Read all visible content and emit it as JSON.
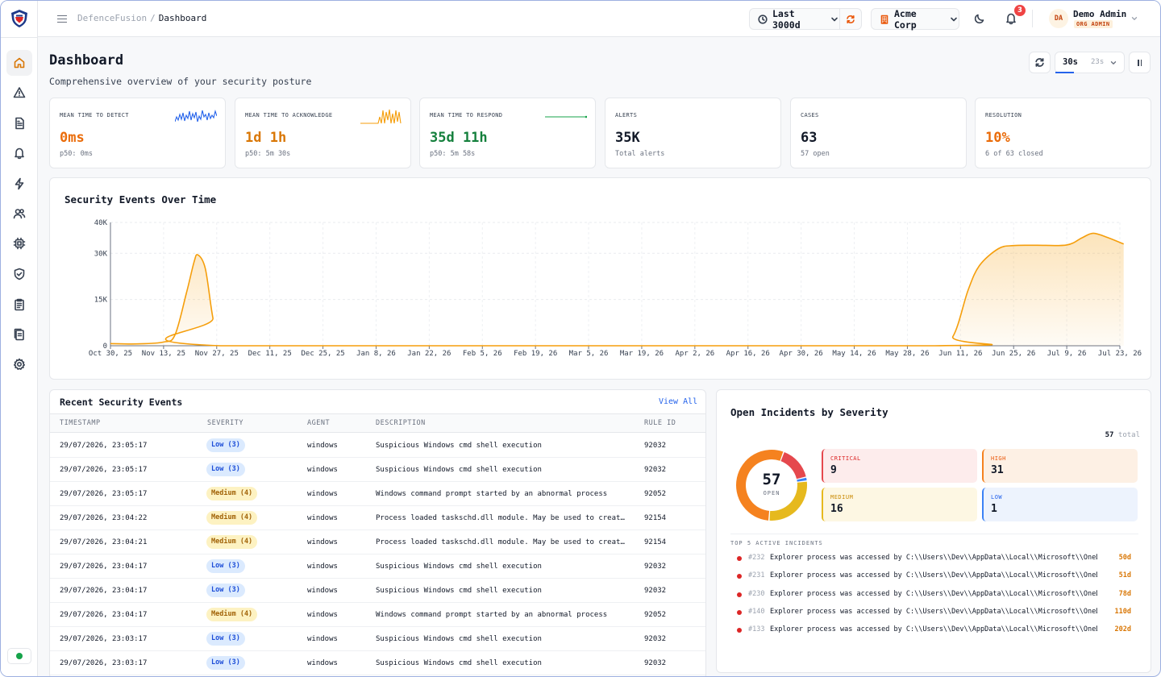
{
  "app": {
    "breadcrumb_root": "DefenceFusion",
    "breadcrumb_sep": "/",
    "breadcrumb_current": "Dashboard"
  },
  "topbar": {
    "time_range": "Last 3000d",
    "org": "Acme Corp",
    "notifications_count": "3",
    "user_initials": "DA",
    "user_name": "Demo Admin",
    "user_role": "ORG ADMIN"
  },
  "page": {
    "title": "Dashboard",
    "subtitle": "Comprehensive overview of your security posture",
    "refresh_interval": "30s",
    "refresh_countdown": "23s"
  },
  "stats": [
    {
      "label": "MEAN TIME TO DETECT",
      "value": "0ms",
      "sub": "p50: 0ms",
      "color": "#ea6c0a",
      "spark": "blue"
    },
    {
      "label": "MEAN TIME TO ACKNOWLEDGE",
      "value": "1d 1h",
      "sub": "p50: 5m 30s",
      "color": "#d97706",
      "spark": "orange"
    },
    {
      "label": "MEAN TIME TO RESPOND",
      "value": "35d 11h",
      "sub": "p50: 5m 58s",
      "color": "#15803d",
      "spark": "green"
    },
    {
      "label": "ALERTS",
      "value": "35K",
      "sub": "Total alerts",
      "color": "#111827"
    },
    {
      "label": "CASES",
      "value": "63",
      "sub": "57 open",
      "color": "#111827"
    },
    {
      "label": "RESOLUTION",
      "value": "10%",
      "sub": "6 of 63 closed",
      "color": "#ea6c0a"
    }
  ],
  "chart_data": {
    "type": "area",
    "title": "Security Events Over Time",
    "x": [
      "Oct 30, 25",
      "Nov 13, 25",
      "Nov 27, 25",
      "Dec 11, 25",
      "Dec 25, 25",
      "Jan 8, 26",
      "Jan 22, 26",
      "Feb 5, 26",
      "Feb 19, 26",
      "Mar 5, 26",
      "Mar 19, 26",
      "Apr 2, 26",
      "Apr 16, 26",
      "Apr 30, 26",
      "May 14, 26",
      "May 28, 26",
      "Jun 11, 26",
      "Jun 25, 26",
      "Jul 9, 26",
      "Jul 23, 26"
    ],
    "yticks": [
      "0",
      "15K",
      "30K",
      "40K"
    ],
    "ylim": [
      0,
      40000
    ],
    "series": [
      {
        "color": "#f59e0b",
        "points": [
          [
            "2025-10-30",
            700
          ],
          [
            "2025-11-06",
            600
          ],
          [
            "2025-11-13",
            1200
          ],
          [
            "2025-11-16",
            3500
          ],
          [
            "2025-11-19",
            17000
          ],
          [
            "2025-11-21",
            27000
          ],
          [
            "2025-11-22",
            29500
          ],
          [
            "2025-11-24",
            25000
          ],
          [
            "2025-11-26",
            9000
          ],
          [
            "2025-11-28",
            0
          ],
          [
            "2026-06-04",
            0
          ],
          [
            "2026-06-09",
            3000
          ],
          [
            "2026-06-13",
            18000
          ],
          [
            "2026-06-16",
            26000
          ],
          [
            "2026-06-21",
            31500
          ],
          [
            "2026-06-25",
            32500
          ],
          [
            "2026-07-01",
            32600
          ],
          [
            "2026-07-09",
            32700
          ],
          [
            "2026-07-13",
            35000
          ],
          [
            "2026-07-16",
            36500
          ],
          [
            "2026-07-20",
            35000
          ],
          [
            "2026-07-24",
            33000
          ]
        ]
      }
    ],
    "grid": true,
    "legend": "none"
  },
  "events": {
    "title": "Recent Security Events",
    "view_all": "View All",
    "columns": [
      "TIMESTAMP",
      "SEVERITY",
      "AGENT",
      "DESCRIPTION",
      "RULE ID"
    ],
    "rows": [
      {
        "ts": "29/07/2026, 23:05:17",
        "sev": "Low (3)",
        "level": "low",
        "agent": "windows",
        "desc": "Suspicious Windows cmd shell execution",
        "rule": "92032"
      },
      {
        "ts": "29/07/2026, 23:05:17",
        "sev": "Low (3)",
        "level": "low",
        "agent": "windows",
        "desc": "Suspicious Windows cmd shell execution",
        "rule": "92032"
      },
      {
        "ts": "29/07/2026, 23:05:17",
        "sev": "Medium (4)",
        "level": "medium",
        "agent": "windows",
        "desc": "Windows command prompt started by an abnormal process",
        "rule": "92052"
      },
      {
        "ts": "29/07/2026, 23:04:22",
        "sev": "Medium (4)",
        "level": "medium",
        "agent": "windows",
        "desc": "Process loaded taskschd.dll module. May be used to create …",
        "rule": "92154"
      },
      {
        "ts": "29/07/2026, 23:04:21",
        "sev": "Medium (4)",
        "level": "medium",
        "agent": "windows",
        "desc": "Process loaded taskschd.dll module. May be used to create …",
        "rule": "92154"
      },
      {
        "ts": "29/07/2026, 23:04:17",
        "sev": "Low (3)",
        "level": "low",
        "agent": "windows",
        "desc": "Suspicious Windows cmd shell execution",
        "rule": "92032"
      },
      {
        "ts": "29/07/2026, 23:04:17",
        "sev": "Low (3)",
        "level": "low",
        "agent": "windows",
        "desc": "Suspicious Windows cmd shell execution",
        "rule": "92032"
      },
      {
        "ts": "29/07/2026, 23:04:17",
        "sev": "Medium (4)",
        "level": "medium",
        "agent": "windows",
        "desc": "Windows command prompt started by an abnormal process",
        "rule": "92052"
      },
      {
        "ts": "29/07/2026, 23:03:17",
        "sev": "Low (3)",
        "level": "low",
        "agent": "windows",
        "desc": "Suspicious Windows cmd shell execution",
        "rule": "92032"
      },
      {
        "ts": "29/07/2026, 23:03:17",
        "sev": "Low (3)",
        "level": "low",
        "agent": "windows",
        "desc": "Suspicious Windows cmd shell execution",
        "rule": "92032"
      }
    ]
  },
  "incidents": {
    "title": "Open Incidents by Severity",
    "total": "57",
    "total_label": "total",
    "donut_value": "57",
    "donut_label": "OPEN",
    "severities": [
      {
        "label": "CRITICAL",
        "value": 9,
        "color": "#e5484d",
        "bg": "#fdecec",
        "text": "#dc2626"
      },
      {
        "label": "HIGH",
        "value": 31,
        "color": "#f5821f",
        "bg": "#fdf0e4",
        "text": "#ea580c"
      },
      {
        "label": "MEDIUM",
        "value": 16,
        "color": "#e6b91e",
        "bg": "#fdf7e3",
        "text": "#ca8a04"
      },
      {
        "label": "LOW",
        "value": 1,
        "color": "#3b82f6",
        "bg": "#edf3fd",
        "text": "#2563eb"
      }
    ],
    "top5_label": "TOP 5 ACTIVE INCIDENTS",
    "top5": [
      {
        "id": "#232",
        "text": "Explorer process was accessed by C:\\\\Users\\\\Dev\\\\AppData\\\\Local\\\\Microsoft\\\\OneDr…",
        "age": "50d"
      },
      {
        "id": "#231",
        "text": "Explorer process was accessed by C:\\\\Users\\\\Dev\\\\AppData\\\\Local\\\\Microsoft\\\\OneDr…",
        "age": "51d"
      },
      {
        "id": "#230",
        "text": "Explorer process was accessed by C:\\\\Users\\\\Dev\\\\AppData\\\\Local\\\\Microsoft\\\\OneDr…",
        "age": "78d"
      },
      {
        "id": "#140",
        "text": "Explorer process was accessed by C:\\\\Users\\\\Dev\\\\AppData\\\\Local\\\\Microsoft\\\\OneDr…",
        "age": "110d"
      },
      {
        "id": "#133",
        "text": "Explorer process was accessed by C:\\\\Users\\\\Dev\\\\AppData\\\\Local\\\\Microsoft\\\\OneD…",
        "age": "202d"
      }
    ]
  }
}
